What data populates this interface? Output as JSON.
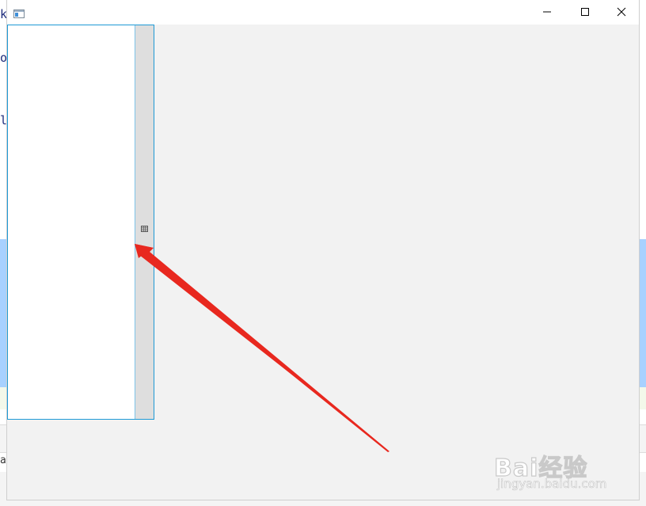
{
  "background": {
    "editor_chars": [
      "k",
      "o",
      "l",
      "a"
    ]
  },
  "window": {
    "title": "",
    "icon": "app-window-icon",
    "controls": {
      "minimize": "minimize-icon",
      "maximize": "maximize-icon",
      "close": "close-icon"
    },
    "listbox": {
      "items": [],
      "scrollbar_grip": "grip-icon"
    }
  },
  "annotation": {
    "arrow_color": "#e8281f"
  },
  "watermark": {
    "logo": "Bai经验",
    "url": "jingyan.baidu.com"
  }
}
